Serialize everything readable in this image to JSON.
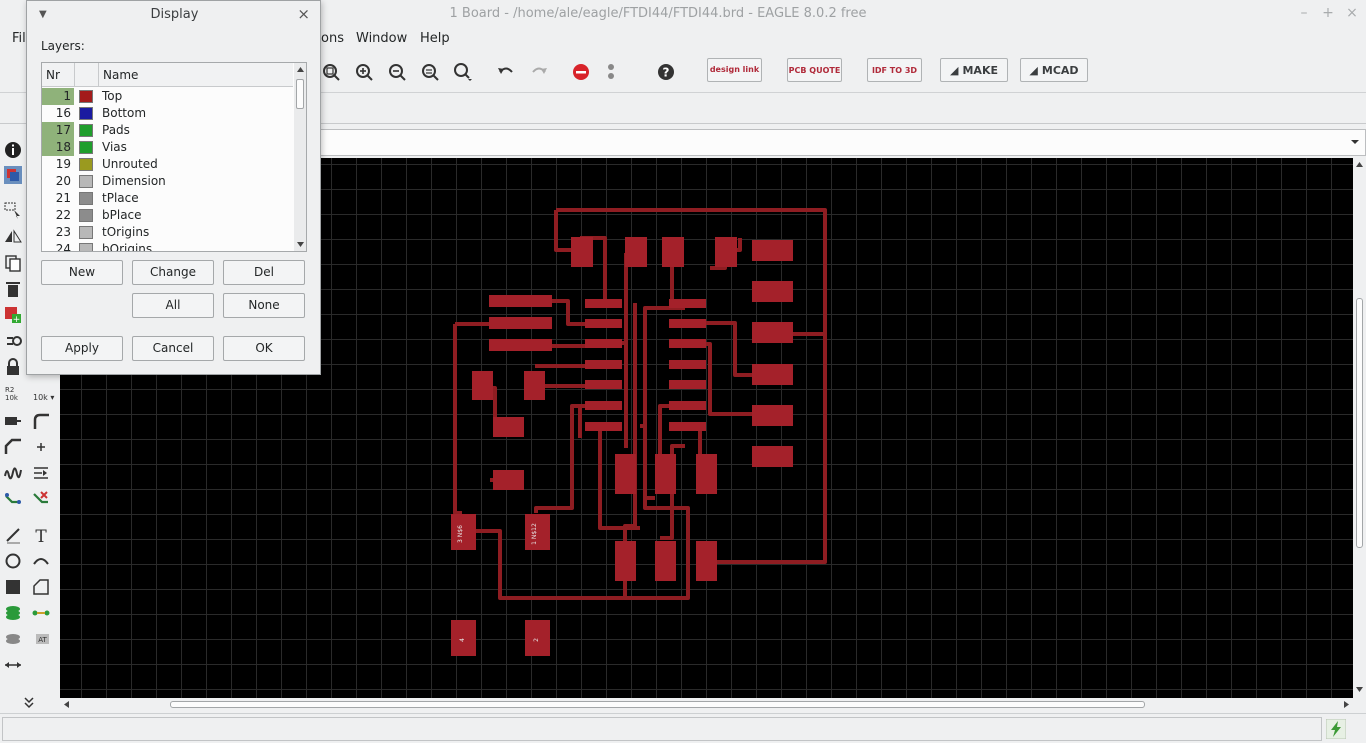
{
  "window": {
    "title": "1 Board - /home/ale/eagle/FTDI44/FTDI44.brd - EAGLE 8.0.2 free"
  },
  "menubar": {
    "items": [
      "File",
      "ons",
      "Window",
      "Help"
    ]
  },
  "toolbar": {
    "buttons": [
      {
        "label": "design link"
      },
      {
        "label": "PCB QUOTE"
      },
      {
        "label": "IDF TO 3D"
      },
      {
        "label": "MAKE"
      },
      {
        "label": "MCAD"
      }
    ]
  },
  "palette": {
    "grid_labels": [
      "R2",
      "10k",
      "10k"
    ]
  },
  "dialog": {
    "title": "Display",
    "layers_label": "Layers:",
    "columns": [
      "Nr",
      "Name"
    ],
    "layers": [
      {
        "nr": "1",
        "name": "Top",
        "color": "#a31b1b",
        "selected": true
      },
      {
        "nr": "16",
        "name": "Bottom",
        "color": "#1a1aa0",
        "selected": false
      },
      {
        "nr": "17",
        "name": "Pads",
        "color": "#1f9e2c",
        "selected": true
      },
      {
        "nr": "18",
        "name": "Vias",
        "color": "#1f9e2c",
        "selected": true
      },
      {
        "nr": "19",
        "name": "Unrouted",
        "color": "#9a9a1f",
        "selected": false
      },
      {
        "nr": "20",
        "name": "Dimension",
        "color": "#b8b8b8",
        "selected": false
      },
      {
        "nr": "21",
        "name": "tPlace",
        "color": "#8c8c8c",
        "selected": false
      },
      {
        "nr": "22",
        "name": "bPlace",
        "color": "#8c8c8c",
        "selected": false
      },
      {
        "nr": "23",
        "name": "tOrigins",
        "color": "#b8b8b8",
        "selected": false
      },
      {
        "nr": "24",
        "name": "bOrigins",
        "color": "#b8b8b8",
        "selected": false
      }
    ],
    "buttons": {
      "new": "New",
      "change": "Change",
      "del": "Del",
      "all": "All",
      "none": "None",
      "apply": "Apply",
      "cancel": "Cancel",
      "ok": "OK"
    }
  },
  "board": {
    "trace_color": "#8f1d22",
    "pad_color": "#a4212a",
    "pad_labels": [
      "3 N$6",
      "1 N$12",
      "4",
      "2"
    ]
  },
  "colors": {
    "canvas_bg": "#000000",
    "grid": "#2a2a2a",
    "selected_layer": "#8fb27a"
  }
}
